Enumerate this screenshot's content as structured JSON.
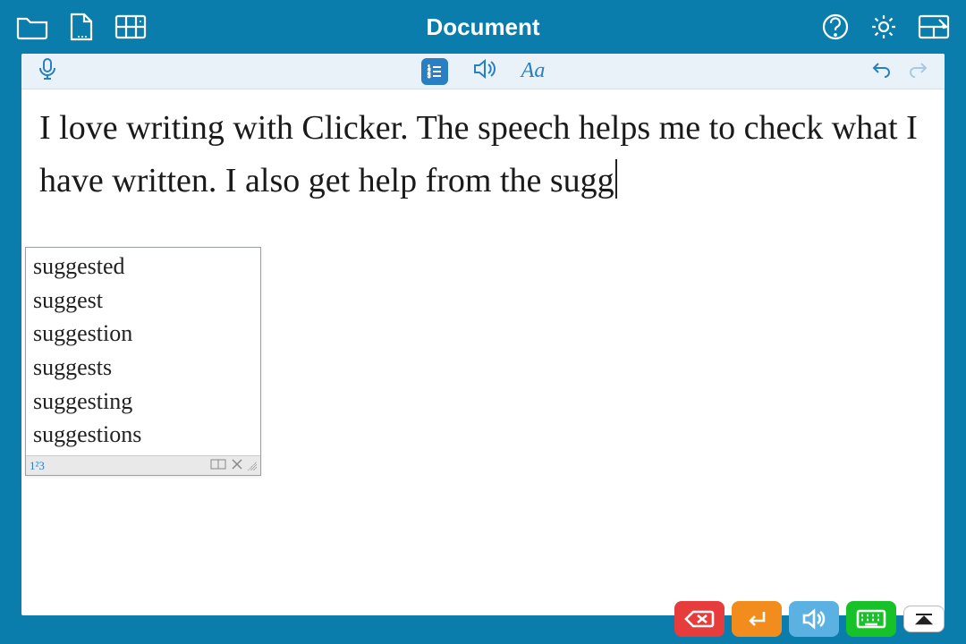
{
  "title": "Document",
  "editor": {
    "text": "I love writing with Clicker. The speech helps me to check what I have written. I also get help from the sugg"
  },
  "suggestions": {
    "items": [
      "suggested",
      "suggest",
      "suggestion",
      "suggests",
      "suggesting",
      "suggestions"
    ],
    "footer_left": "1²3"
  },
  "colors": {
    "brand": "#0a7dad",
    "accent": "#2a7fc2",
    "red": "#e63c3c",
    "orange": "#f28c1c",
    "blue": "#5ab1e2",
    "green": "#17c229"
  }
}
